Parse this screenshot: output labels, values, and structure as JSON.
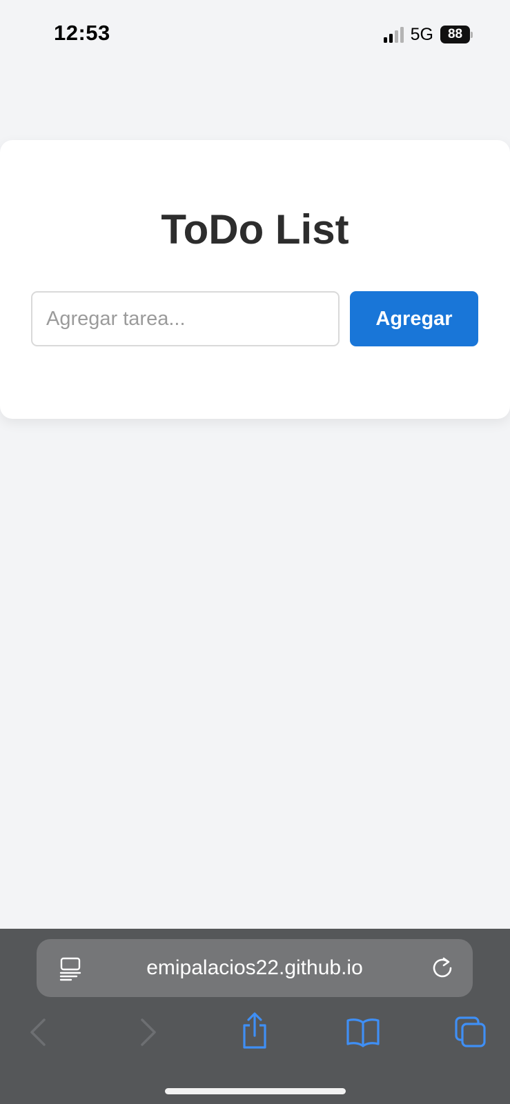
{
  "status_bar": {
    "time": "12:53",
    "network": "5G",
    "battery": "88"
  },
  "app": {
    "title": "ToDo List",
    "input_placeholder": "Agregar tarea...",
    "input_value": "",
    "add_button_label": "Agregar"
  },
  "browser": {
    "url": "emipalacios22.github.io",
    "icons": [
      "reader-icon",
      "reload-icon",
      "back-icon",
      "forward-icon",
      "share-icon",
      "bookmarks-icon",
      "tabs-icon"
    ],
    "accent_color": "#3f8ff5"
  },
  "colors": {
    "page_background": "#f3f4f6",
    "button_background": "#1976d8",
    "title_color": "#2d2d2d",
    "browser_bar": "#555759"
  }
}
